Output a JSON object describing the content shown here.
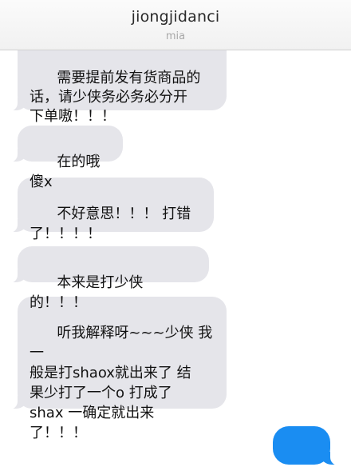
{
  "header": {
    "title": "jiongjidanci",
    "subtitle": "mia"
  },
  "messages": [
    {
      "side": "received",
      "text": "需要提前发有货商品的\n话，请少侠务必务必分开\n下单嗷！！！"
    },
    {
      "side": "received",
      "text": "在的哦 傻x"
    },
    {
      "side": "received",
      "text": "不好意思！！！ 打错\n了！！！！"
    },
    {
      "side": "received",
      "text": "本来是打少侠的！！！"
    },
    {
      "side": "received",
      "text": "听我解释呀~~~少侠 我一\n般是打shaox就出来了 结\n果少打了一个o 打成了\nshax 一确定就出来\n了！！！"
    },
    {
      "side": "sent",
      "text": "......"
    }
  ],
  "colors": {
    "received_bubble": "#e5e5ea",
    "sent_bubble": "#1a8df2",
    "header_bg": "#f4f4f4"
  }
}
